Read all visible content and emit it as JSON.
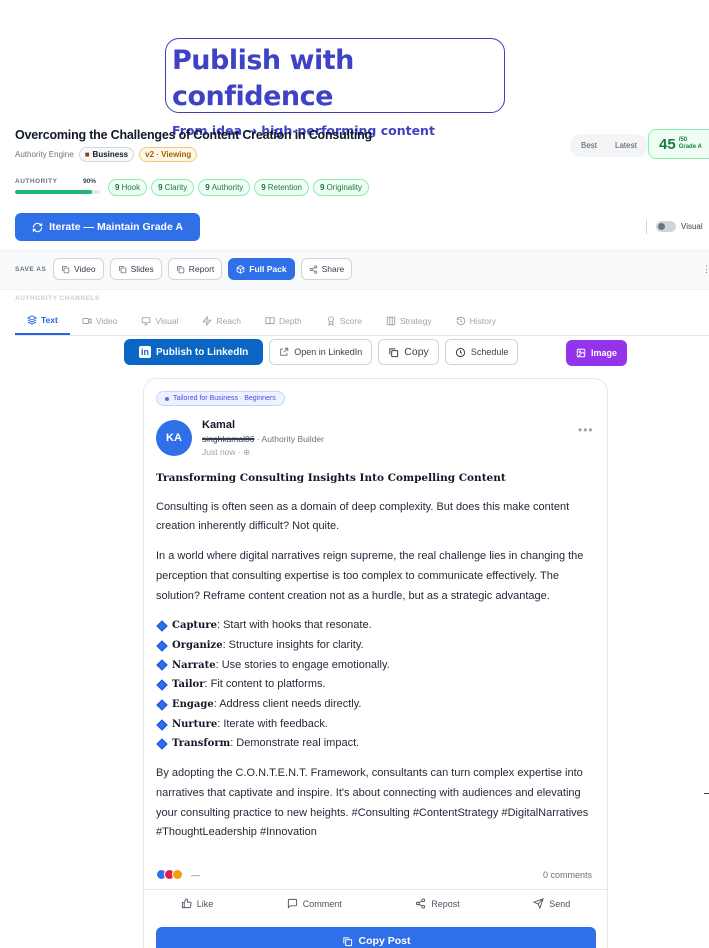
{
  "hero": {
    "title": "Publish with confidence",
    "subtitle": "From idea → high-performing content"
  },
  "document": {
    "title": "Overcoming the Challenges of Content Creation in Consulting",
    "engine": "Authority Engine",
    "audience_badge": "Business",
    "version_badge": "v2 · Viewing"
  },
  "version_toggle": {
    "best_label": "Best",
    "latest_label": "Latest"
  },
  "grade": {
    "score": "45",
    "max": "/50",
    "label": "Grade A"
  },
  "authority": {
    "label": "AUTHORITY",
    "percent_text": "90%",
    "percent": 0.9,
    "metrics": [
      {
        "score": "9",
        "label": "Hook"
      },
      {
        "score": "9",
        "label": "Clarity"
      },
      {
        "score": "9",
        "label": "Authority"
      },
      {
        "score": "9",
        "label": "Retention"
      },
      {
        "score": "9",
        "label": "Originality"
      }
    ]
  },
  "iterate_button": "Iterate — Maintain Grade A",
  "visual_toggle_label": "Visual",
  "save_as": {
    "label": "SAVE AS",
    "buttons": [
      {
        "label": "Video",
        "icon": "copy-icon"
      },
      {
        "label": "Slides",
        "icon": "copy-icon"
      },
      {
        "label": "Report",
        "icon": "copy-icon"
      },
      {
        "label": "Full Pack",
        "icon": "package-icon"
      },
      {
        "label": "Share",
        "icon": "share-icon"
      }
    ]
  },
  "channels": {
    "label": "AUTHORITY CHANNELS",
    "tabs": [
      {
        "label": "Text",
        "icon": "layers-icon"
      },
      {
        "label": "Video",
        "icon": "video-icon"
      },
      {
        "label": "Visual",
        "icon": "presentation-icon"
      },
      {
        "label": "Reach",
        "icon": "zap-icon"
      },
      {
        "label": "Depth",
        "icon": "book-icon"
      },
      {
        "label": "Score",
        "icon": "award-icon"
      },
      {
        "label": "Strategy",
        "icon": "columns-icon"
      },
      {
        "label": "History",
        "icon": "history-icon"
      }
    ]
  },
  "actions": {
    "publish": "Publish to LinkedIn",
    "open": "Open in LinkedIn",
    "copy": "Copy",
    "schedule": "Schedule",
    "image": "Image"
  },
  "post": {
    "tailored": "Tailored for Business · Beginners",
    "avatar_initials": "KA",
    "author": "Kamal",
    "handle": "singhkamal06",
    "role": " · Authority Builder",
    "time": "Just now · ⊕",
    "title": "Transforming Consulting Insights Into Compelling Content",
    "paragraphs": [
      "Consulting is often seen as a domain of deep complexity. But does this make content creation inherently difficult? Not quite.",
      "In a world where digital narratives reign supreme, the real challenge lies in changing the perception that consulting expertise is too complex to communicate effectively. The solution? Reframe content creation not as a hurdle, but as a strategic advantage."
    ],
    "framework": [
      {
        "term": "Capture",
        "text": ": Start with hooks that resonate."
      },
      {
        "term": "Organize",
        "text": ": Structure insights for clarity."
      },
      {
        "term": "Narrate",
        "text": ": Use stories to engage emotionally."
      },
      {
        "term": "Tailor",
        "text": ": Fit content to platforms."
      },
      {
        "term": "Engage",
        "text": ": Address client needs directly."
      },
      {
        "term": "Nurture",
        "text": ": Iterate with feedback."
      },
      {
        "term": "Transform",
        "text": ": Demonstrate real impact."
      }
    ],
    "closing": "By adopting the C.O.N.T.E.N.T. Framework, consultants can turn complex expertise into narratives that captivate and inspire. It's about connecting with audiences and elevating your consulting practice to new heights. #Consulting #ContentStrategy #DigitalNarratives #ThoughtLeadership #Innovation",
    "reactions_text": "—",
    "comments": "0 comments",
    "engage": [
      "Like",
      "Comment",
      "Repost",
      "Send"
    ],
    "copy_post": "Copy Post"
  },
  "colors": {
    "accent": "#2f6fe8",
    "hero": "#3d43c4",
    "success": "#15803d",
    "linkedin": "#0a66c2",
    "image_button": "#9333ea"
  }
}
